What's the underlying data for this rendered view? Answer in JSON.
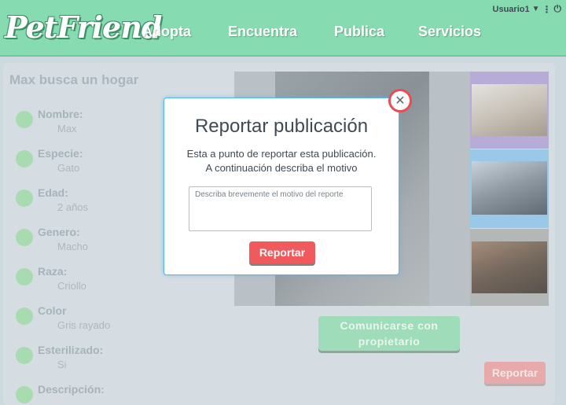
{
  "header": {
    "logo": "PetFriend",
    "nav": [
      "Adopta",
      "Encuentra",
      "Publica",
      "Servicios"
    ],
    "user": "Usuario1",
    "icons": [
      "caret-down-icon",
      "more-vert-icon",
      "power-icon"
    ]
  },
  "pet": {
    "title": "Max busca un hogar",
    "fields": [
      {
        "label": "Nombre:",
        "value": "Max"
      },
      {
        "label": "Especie:",
        "value": "Gato"
      },
      {
        "label": "Edad:",
        "value": "2 años"
      },
      {
        "label": "Genero:",
        "value": "Macho"
      },
      {
        "label": "Raza:",
        "value": "Criollo"
      },
      {
        "label": "Color",
        "value": "Gris rayado"
      },
      {
        "label": "Esterilizado:",
        "value": "Si"
      },
      {
        "label": "Descripción:",
        "value": ""
      }
    ]
  },
  "actions": {
    "contact": "Comunicarse con propietario",
    "report": "Reportar"
  },
  "modal": {
    "title": "Reportar publicación",
    "message_line1": "Esta a punto de reportar esta publicación.",
    "message_line2": "A continuación describa el motivo",
    "placeholder": "Describa brevemente el motivo del reporte",
    "submit": "Reportar",
    "close_icon": "close-icon"
  },
  "colors": {
    "header": "#86dcb0",
    "accent_green": "#9fdcb9",
    "danger": "#f05a5d",
    "modal_border": "#57b6e8"
  }
}
